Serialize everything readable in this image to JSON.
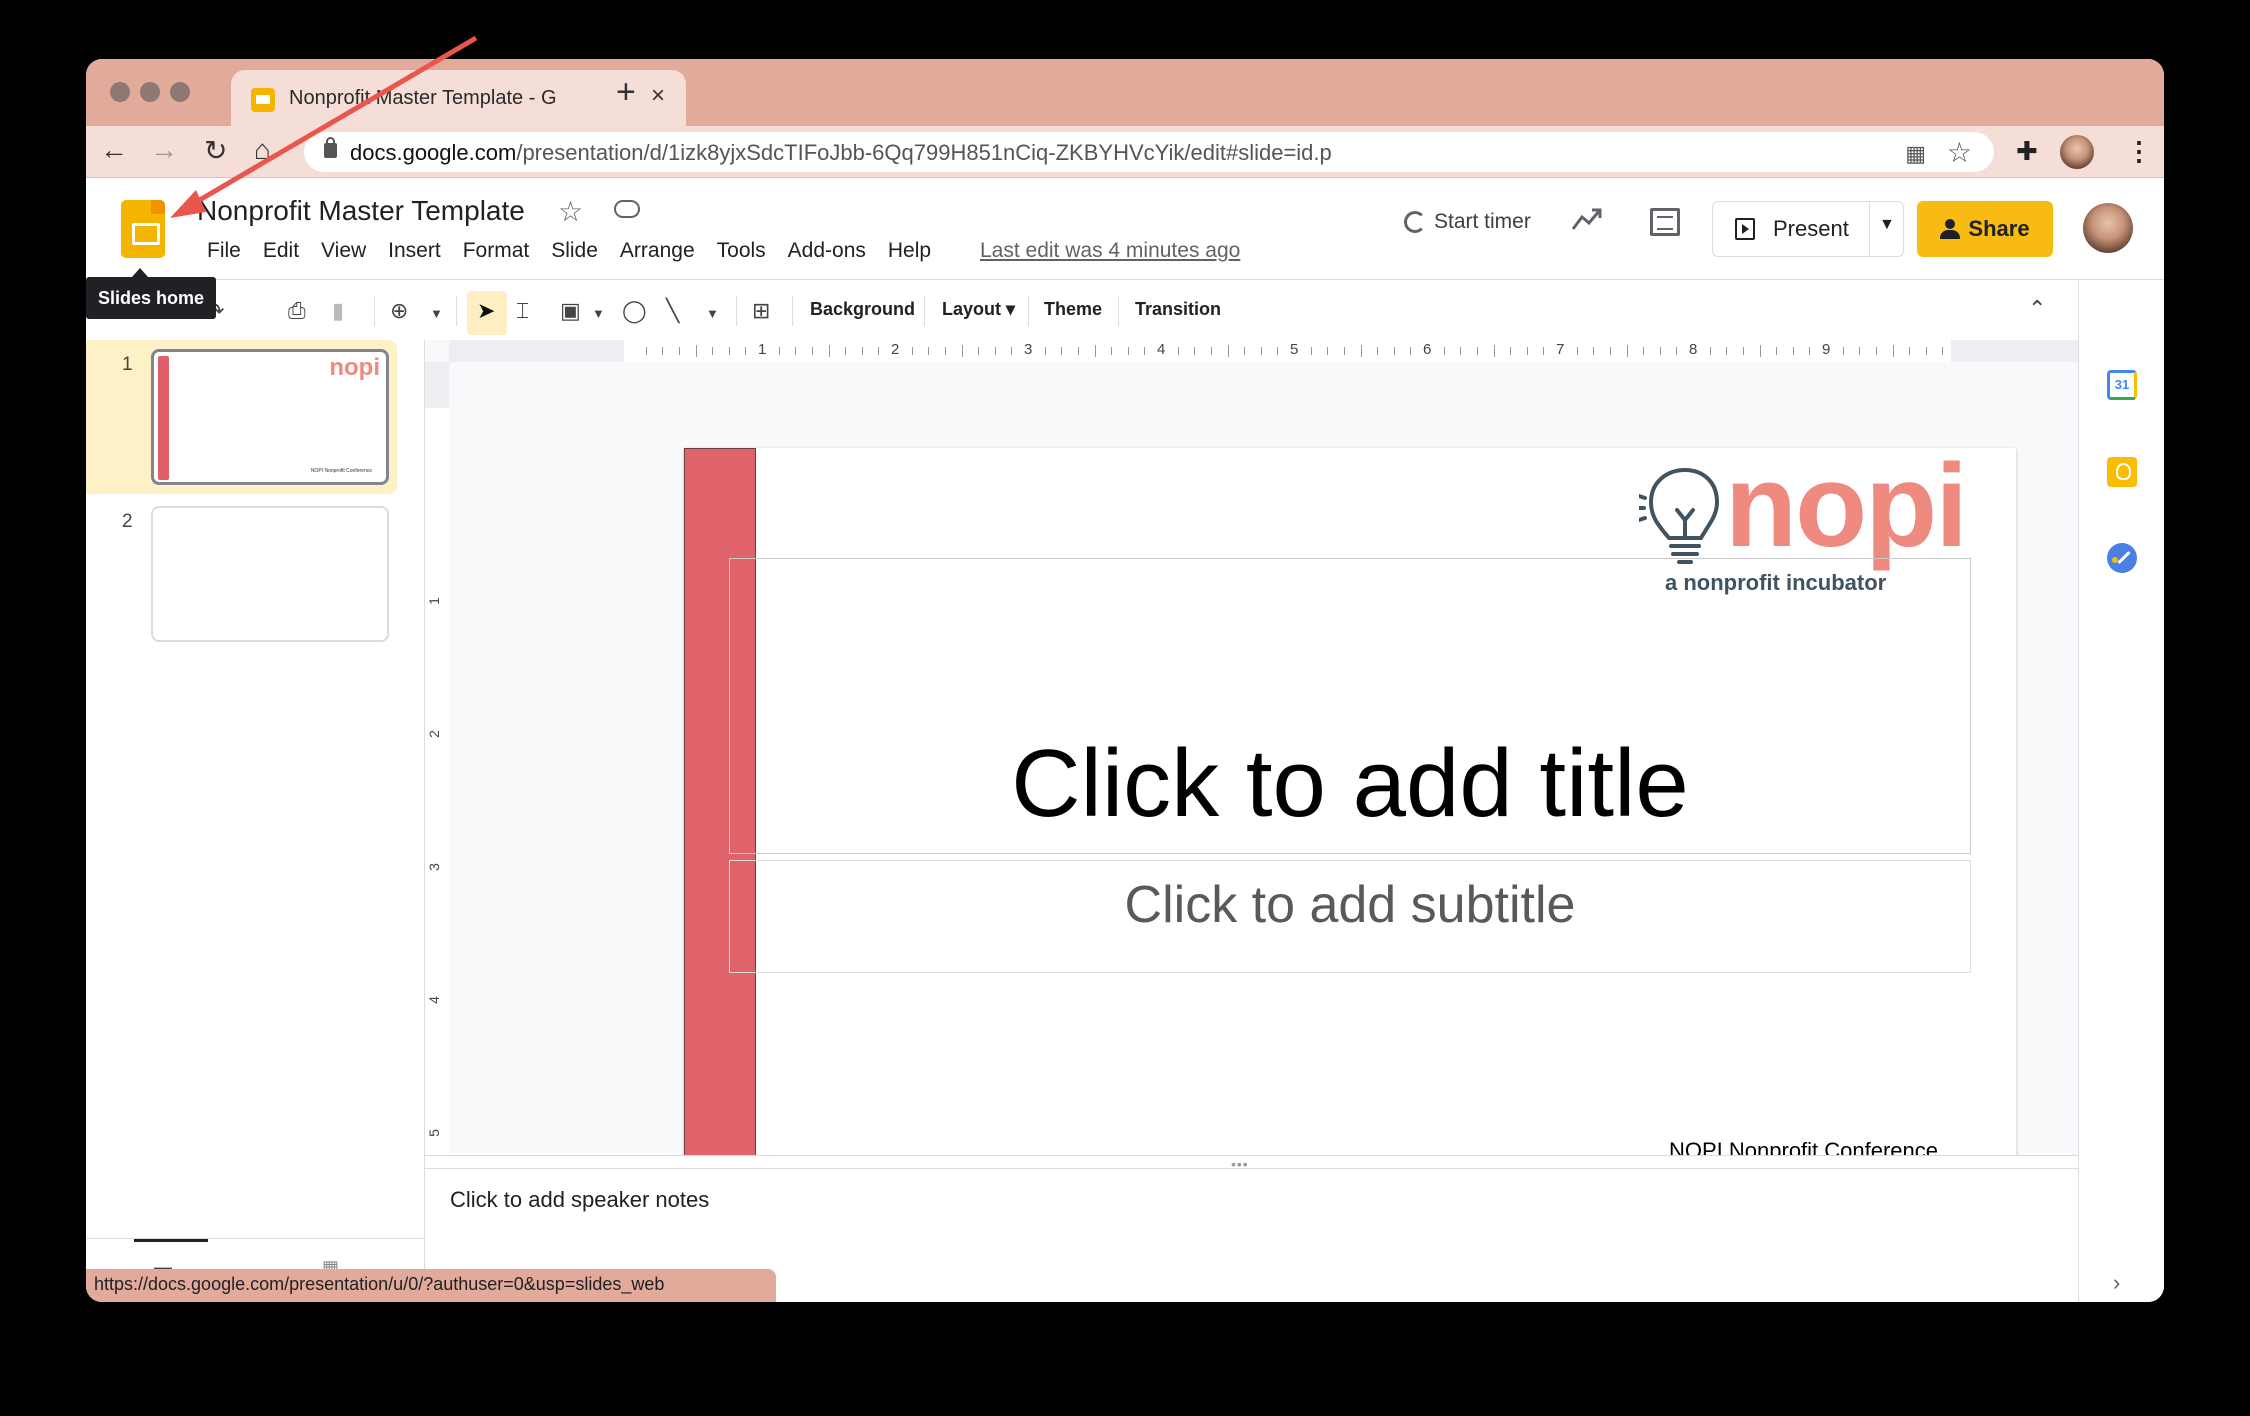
{
  "browser": {
    "tab_title": "Nonprofit Master Template - Google Slides",
    "tab_title_visible": "Nonprofit Master Template - G",
    "close_tab": "×",
    "new_tab": "+",
    "url_host": "docs.google.com",
    "url_path": "/presentation/d/1izk8yjxSdcTIFoJbb-6Qq799H851nCiq-ZKBYHVcYik/edit#slide=id.p",
    "status_url": "https://docs.google.com/presentation/u/0/?authuser=0&usp=slides_web"
  },
  "header": {
    "doc_title": "Nonprofit Master Template",
    "menu": [
      "File",
      "Edit",
      "View",
      "Insert",
      "Format",
      "Slide",
      "Arrange",
      "Tools",
      "Add-ons",
      "Help"
    ],
    "last_edit": "Last edit was 4 minutes ago",
    "start_timer": "Start timer",
    "present": "Present",
    "share": "Share",
    "home_tooltip": "Slides home"
  },
  "toolbar": {
    "background": "Background",
    "layout": "Layout",
    "theme": "Theme",
    "transition": "Transition"
  },
  "ruler": {
    "h_numbers": [
      "1",
      "2",
      "3",
      "4",
      "5",
      "6",
      "7",
      "8",
      "9"
    ],
    "v_numbers": [
      "1",
      "2",
      "3",
      "4",
      "5"
    ]
  },
  "filmstrip": {
    "slides": [
      {
        "number": "1",
        "selected": true,
        "logo": "nopi",
        "footer": "NOPI Nonprofit Conference"
      },
      {
        "number": "2",
        "selected": false
      }
    ]
  },
  "slide": {
    "title_placeholder": "Click to add title",
    "subtitle_placeholder": "Click to add subtitle",
    "logo_text": "nopi",
    "logo_tagline": "a nonprofit incubator",
    "footer": "NOPI Nonprofit Conference",
    "accent_color": "#e0626a",
    "logo_color": "#ef8a80"
  },
  "notes": {
    "placeholder": "Click to add speaker notes"
  },
  "sidebar": {
    "calendar_day": "31"
  },
  "colors": {
    "chrome_frame": "#e2aa9b",
    "share_button": "#f8bb14",
    "selected_thumb_bg": "#fef0c7"
  }
}
